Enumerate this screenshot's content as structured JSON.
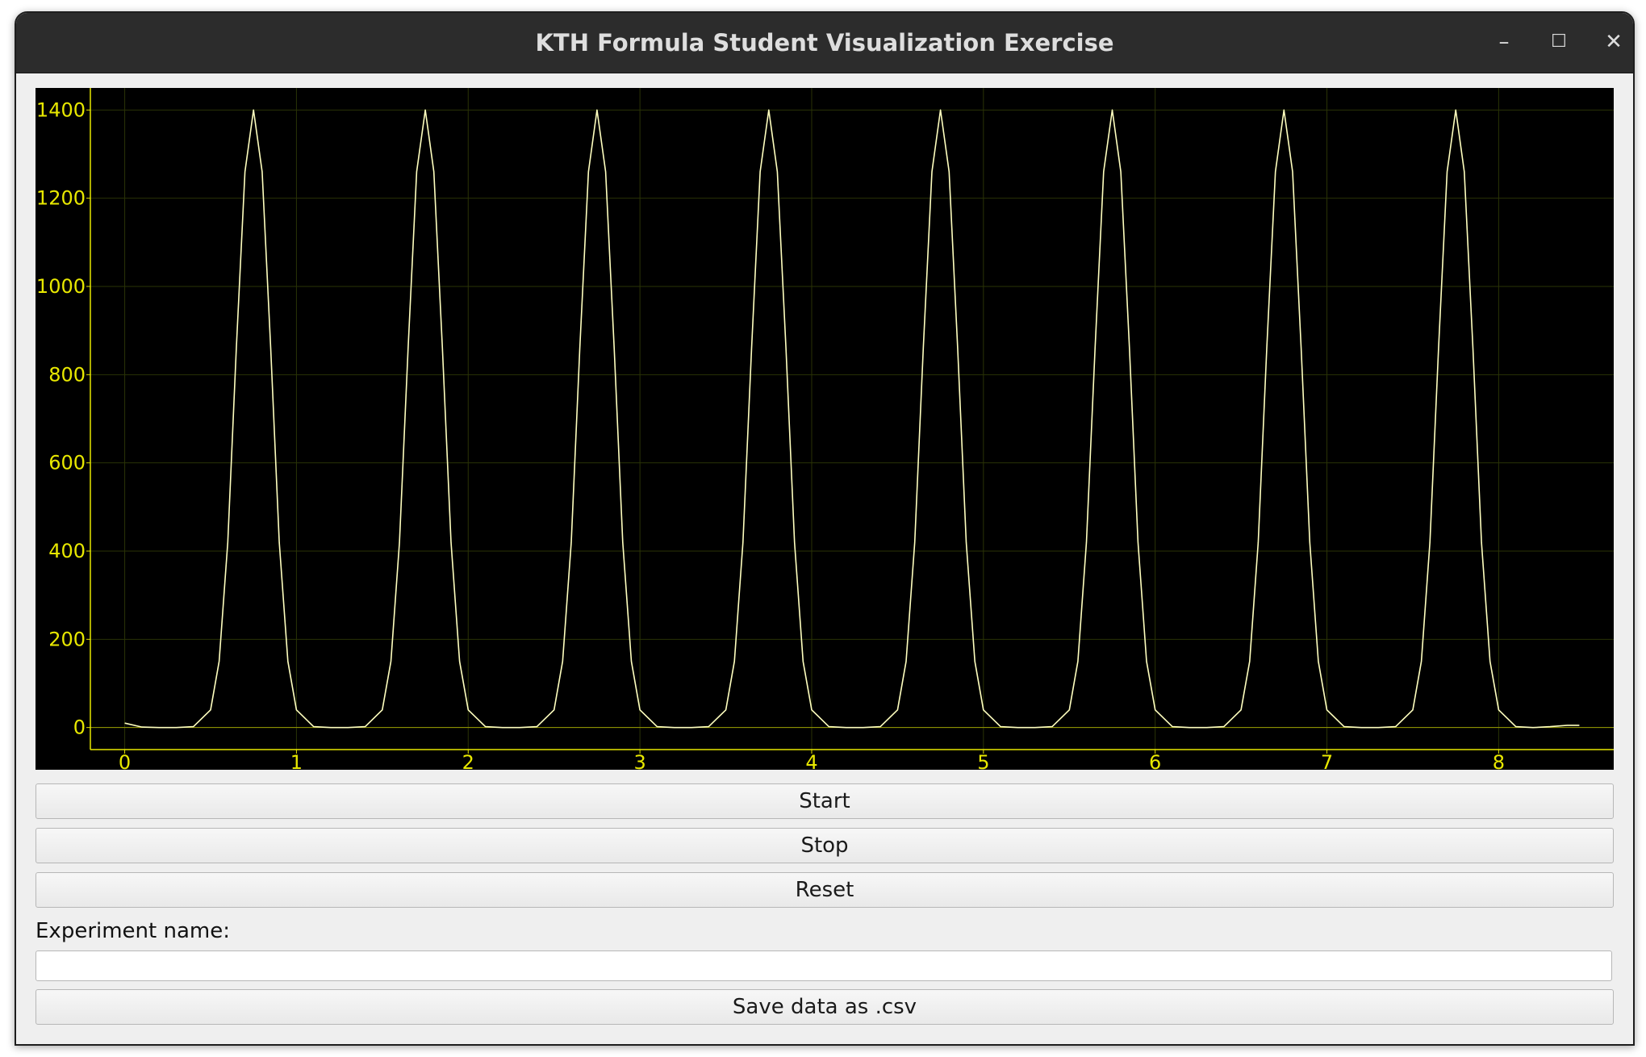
{
  "window": {
    "title": "KTH Formula Student Visualization Exercise",
    "controls": {
      "minimize_icon": "minimize-icon",
      "maximize_icon": "maximize-icon",
      "close_icon": "close-icon"
    }
  },
  "chart_data": {
    "type": "line",
    "title": "",
    "xlabel": "",
    "ylabel": "",
    "xlim": [
      -0.2,
      8.67
    ],
    "ylim": [
      -50,
      1450
    ],
    "x_ticks": [
      0,
      1,
      2,
      3,
      4,
      5,
      6,
      7,
      8
    ],
    "y_ticks": [
      0,
      200,
      400,
      600,
      800,
      1000,
      1200,
      1400
    ],
    "grid": true,
    "colors": {
      "background": "#000000",
      "axis": "#e8e800",
      "grid": "#2a3306",
      "series": "#ffffbf"
    },
    "series": [
      {
        "x": [
          0.0,
          0.1,
          0.2,
          0.3,
          0.4,
          0.5,
          0.55,
          0.6,
          0.65,
          0.7,
          0.75,
          0.8,
          0.85,
          0.9,
          0.95,
          1.0,
          1.1,
          1.2,
          1.3,
          1.4,
          1.5,
          1.55,
          1.6,
          1.65,
          1.7,
          1.75,
          1.8,
          1.85,
          1.9,
          1.95,
          2.0,
          2.1,
          2.2,
          2.3,
          2.4,
          2.5,
          2.55,
          2.6,
          2.65,
          2.7,
          2.75,
          2.8,
          2.85,
          2.9,
          2.95,
          3.0,
          3.1,
          3.2,
          3.3,
          3.4,
          3.5,
          3.55,
          3.6,
          3.65,
          3.7,
          3.75,
          3.8,
          3.85,
          3.9,
          3.95,
          4.0,
          4.1,
          4.2,
          4.3,
          4.4,
          4.5,
          4.55,
          4.6,
          4.65,
          4.7,
          4.75,
          4.8,
          4.85,
          4.9,
          4.95,
          5.0,
          5.1,
          5.2,
          5.3,
          5.4,
          5.5,
          5.55,
          5.6,
          5.65,
          5.7,
          5.75,
          5.8,
          5.85,
          5.9,
          5.95,
          6.0,
          6.1,
          6.2,
          6.3,
          6.4,
          6.5,
          6.55,
          6.6,
          6.65,
          6.7,
          6.75,
          6.8,
          6.85,
          6.9,
          6.95,
          7.0,
          7.1,
          7.2,
          7.3,
          7.4,
          7.5,
          7.55,
          7.6,
          7.65,
          7.7,
          7.75,
          7.8,
          7.85,
          7.9,
          7.95,
          8.0,
          8.1,
          8.2,
          8.3,
          8.4,
          8.47
        ],
        "y": [
          10,
          1,
          0,
          0,
          2,
          40,
          150,
          420,
          860,
          1260,
          1400,
          1260,
          860,
          420,
          150,
          40,
          2,
          0,
          0,
          2,
          40,
          150,
          420,
          860,
          1260,
          1400,
          1260,
          860,
          420,
          150,
          40,
          2,
          0,
          0,
          2,
          40,
          150,
          420,
          860,
          1260,
          1400,
          1260,
          860,
          420,
          150,
          40,
          2,
          0,
          0,
          2,
          40,
          150,
          420,
          860,
          1260,
          1400,
          1260,
          860,
          420,
          150,
          40,
          2,
          0,
          0,
          2,
          40,
          150,
          420,
          860,
          1260,
          1400,
          1260,
          860,
          420,
          150,
          40,
          2,
          0,
          0,
          2,
          40,
          150,
          420,
          860,
          1260,
          1400,
          1260,
          860,
          420,
          150,
          40,
          2,
          0,
          0,
          2,
          40,
          150,
          420,
          860,
          1260,
          1400,
          1260,
          860,
          420,
          150,
          40,
          2,
          0,
          0,
          2,
          40,
          150,
          420,
          860,
          1260,
          1400,
          1260,
          860,
          420,
          150,
          40,
          2,
          0,
          2,
          5,
          5
        ]
      }
    ]
  },
  "controls": {
    "start_label": "Start",
    "stop_label": "Stop",
    "reset_label": "Reset",
    "experiment_label": "Experiment name:",
    "experiment_value": "",
    "save_label": "Save data as .csv"
  }
}
